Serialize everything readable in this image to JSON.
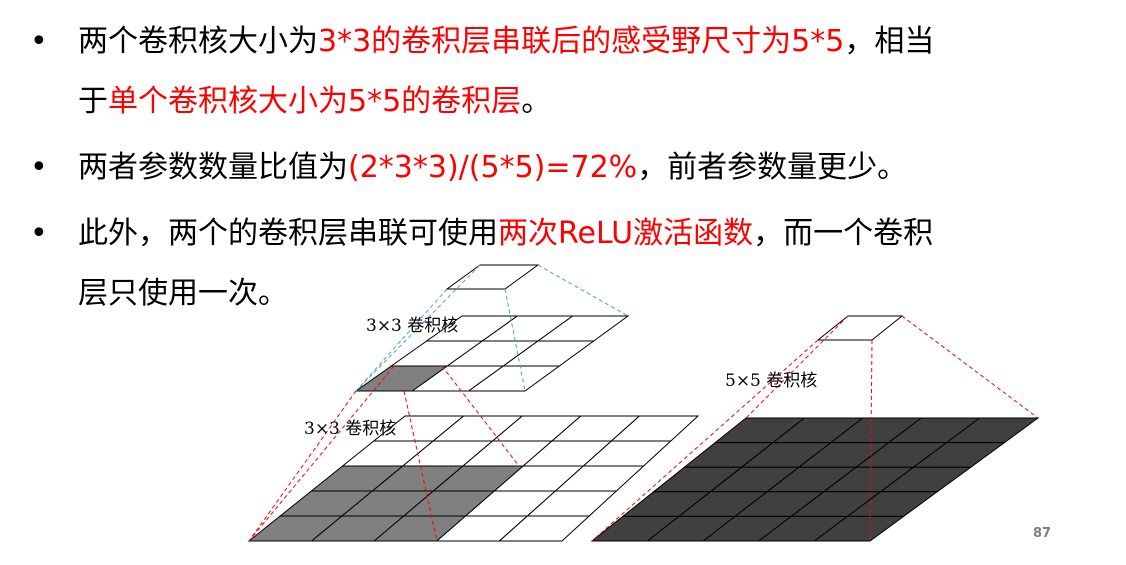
{
  "text": {
    "b1_l1_a": "两个卷积核大小为",
    "b1_l1_b": "3*3的卷积层串联后的感受野尺寸为5*5",
    "b1_l1_c": "，相当",
    "b1_l2_a": "于",
    "b1_l2_b": "单个卷积核大小为5*5的卷积层",
    "b1_l2_c": "。",
    "b2_a": "两者参数数量比值为",
    "b2_b": "(2*3*3)/(5*5)=72%",
    "b2_c": "，前者参数量更少。",
    "b3_l1_a": "此外，两个的卷积层串联可使用",
    "b3_l1_b": "两次ReLU激活函数",
    "b3_l1_c": "，而一个卷积",
    "b3_l2": "层只使用一次。"
  },
  "bullet_symbol": "•",
  "diagram": {
    "label_top": "3×3 卷积核",
    "label_mid": "3×3 卷积核",
    "label_right": "5×5 卷积核"
  },
  "page_number": "87",
  "colors": {
    "highlight": "#ff0000",
    "grid_gray": "#808080",
    "grid_dark": "#404040",
    "dash_red": "#ff0000",
    "dash_blue": "#4f9fcf"
  }
}
